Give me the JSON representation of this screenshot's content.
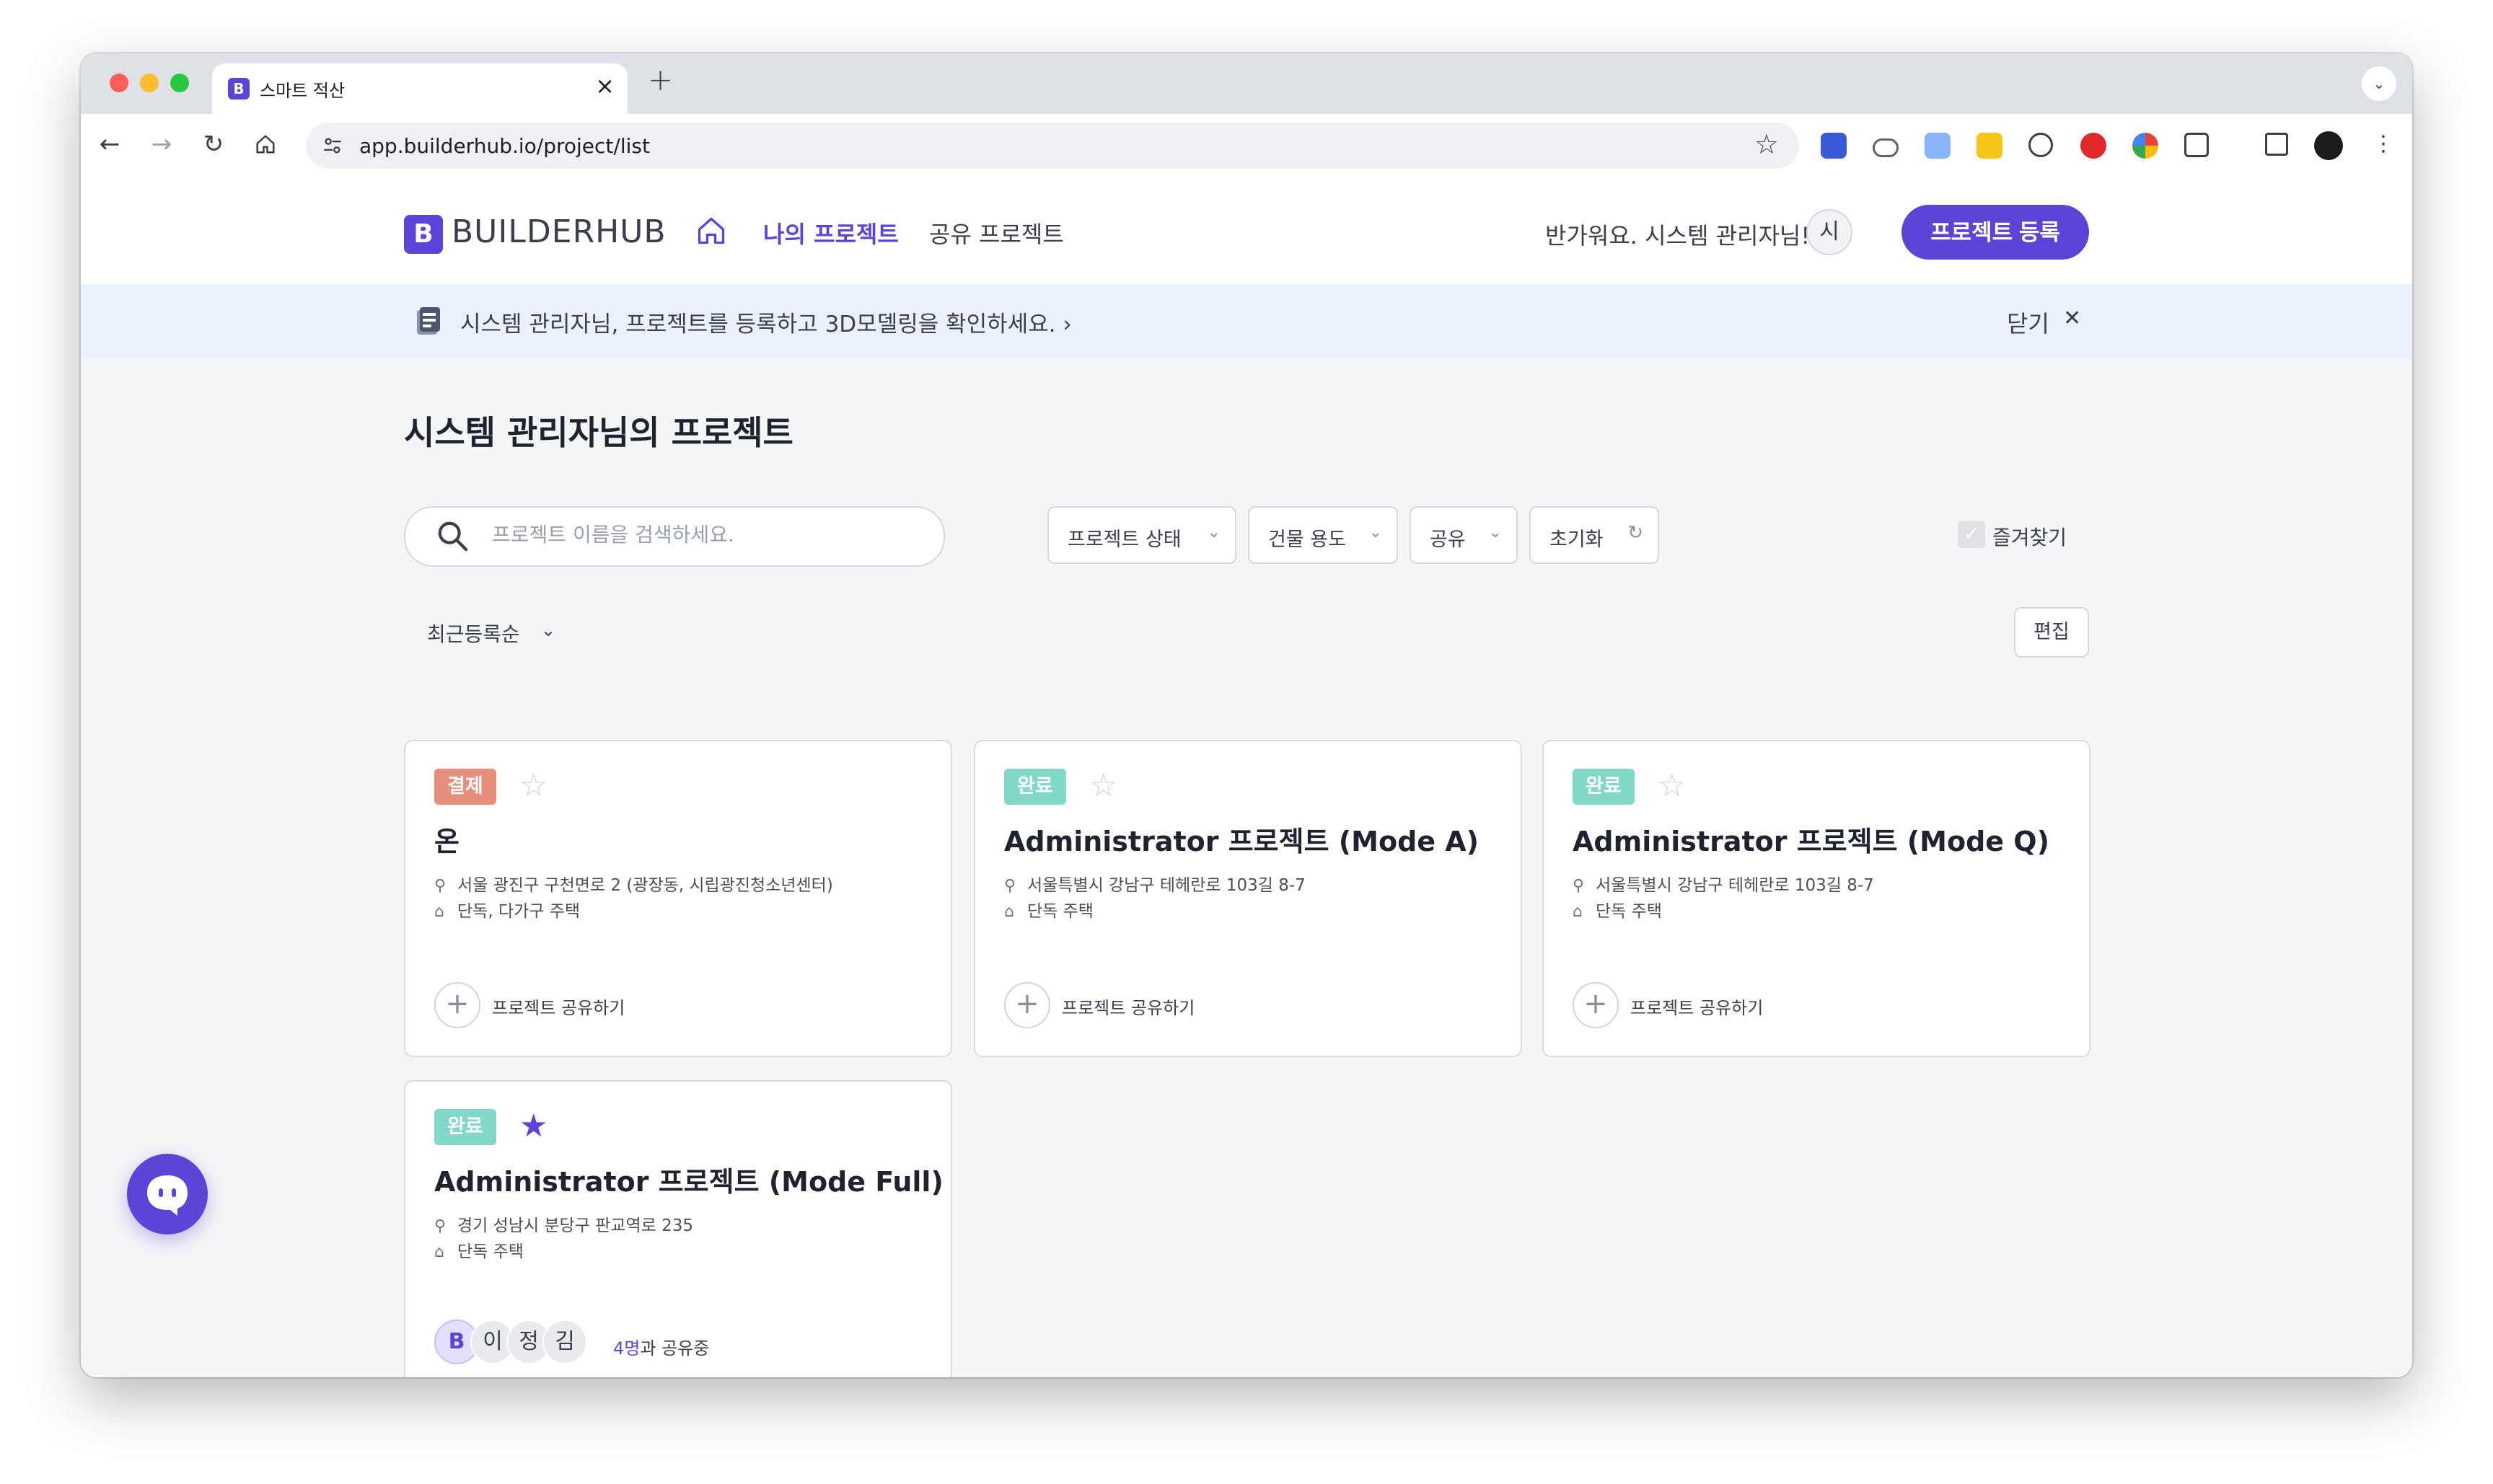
{
  "browser": {
    "tab_title": "스마트 적산",
    "url": "app.builderhub.io/project/list",
    "traffic_colors": [
      "#ff5f57",
      "#febc2e",
      "#28c840"
    ]
  },
  "header": {
    "logo_text": "BUILDERHUB",
    "nav_my": "나의 프로젝트",
    "nav_shared": "공유 프로젝트",
    "greeting": "반가워요. 시스템 관리자님!",
    "avatar": "시",
    "register": "프로젝트 등록"
  },
  "banner": {
    "text": "시스템 관리자님, 프로젝트를 등록하고 3D모델링을 확인하세요. ›",
    "close": "닫기",
    "close_x": "✕"
  },
  "main": {
    "title": "시스템 관리자님의 프로젝트",
    "search_placeholder": "프로젝트 이름을 검색하세요.",
    "filters": [
      "프로젝트 상태",
      "건물 용도",
      "공유",
      "초기화"
    ],
    "favorites_label": "즐겨찾기",
    "sort_label": "최근등록순",
    "edit_label": "편집"
  },
  "cards": [
    {
      "status": "결제",
      "title": "온",
      "address": "서울 광진구 구천면로 2 (광장동, 시립광진청소년센터)",
      "type": "단독, 다가구 주택",
      "share_label": "프로젝트 공유하기",
      "starred": false
    },
    {
      "status": "완료",
      "title": "Administrator 프로젝트 (Mode A)",
      "address": "서울특별시 강남구 테헤란로 103길 8-7",
      "type": "단독 주택",
      "share_label": "프로젝트 공유하기",
      "starred": false
    },
    {
      "status": "완료",
      "title": "Administrator 프로젝트 (Mode Q)",
      "address": "서울특별시 강남구 테헤란로 103길 8-7",
      "type": "단독 주택",
      "share_label": "프로젝트 공유하기",
      "starred": false
    },
    {
      "status": "완료",
      "title": "Administrator 프로젝트 (Mode Full)",
      "address": "경기 성남시 분당구 판교역로 235",
      "type": "단독 주택",
      "starred": true,
      "members": [
        "이",
        "정",
        "김"
      ],
      "share_count": "4명",
      "share_suffix": "과 공유중"
    }
  ],
  "colors": {
    "accent": "#5a45d6",
    "badge_pay": "#e88e7c",
    "badge_done": "#82d8c6",
    "banner_bg": "#eaf1fb"
  }
}
